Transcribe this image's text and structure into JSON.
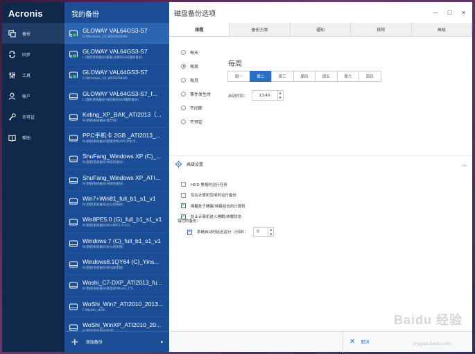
{
  "app": {
    "brand": "Acronis"
  },
  "nav": {
    "items": [
      {
        "label": "备份",
        "icon": "copy-icon",
        "active": true
      },
      {
        "label": "同步",
        "icon": "sync-icon",
        "active": false
      },
      {
        "label": "工具",
        "icon": "tools-icon",
        "active": false
      },
      {
        "label": "帐户",
        "icon": "user-icon",
        "active": false
      },
      {
        "label": "许可证",
        "icon": "key-icon",
        "active": false
      },
      {
        "label": "帮助",
        "icon": "book-icon",
        "active": false
      }
    ]
  },
  "backups": {
    "title": "我的备份",
    "items": [
      {
        "name": "GLOWAY VAL64GS3-S7",
        "path": "E:\\Windows_10_WSSSD\\BAK\\",
        "ok": true
      },
      {
        "name": "GLOWAY VAL64GS3-S7",
        "path": "L:\\我的系统备份\\最备\\龙鹰的SSD最新备份\\",
        "ok": true
      },
      {
        "name": "GLOWAY VAL64GS3-S7",
        "path": "E:\\Windows_10_WSSSD\\BAK\\",
        "ok": true
      },
      {
        "name": "GLOWAY VAL64GS3-S7_f...",
        "path": "L:\\我的系统备份\\书房备份SSD最新备份\\",
        "ok": false
      },
      {
        "name": "Keting_XP_BAK_ATI2013（...",
        "path": "N:\\我的系统备份\\客厅的\\",
        "ok": false
      },
      {
        "name": "PPC手机卡 2GB _ATI2013_...",
        "path": "N:\\我的系统备份\\智能手机\\PPC手机卡...",
        "ok": false
      },
      {
        "name": "ShuFang_Windows XP (C)_...",
        "path": "N:\\我的系统备份\\书房的备份\\",
        "ok": false
      },
      {
        "name": "ShuFang_Windows XP_ATI...",
        "path": "N:\\我的系统备份\\书房的备份\\",
        "ok": false
      },
      {
        "name": "Win7+Win81_full_b1_s1_v1",
        "path": "N:\\我的系统备份\\办公机系统\\",
        "ok": false
      },
      {
        "name": "Win8PE5.0 (G)_full_b1_s1_v1",
        "path": "N:\\我的系统备份\\Win8PE5.0 (G)\\",
        "ok": false
      },
      {
        "name": "Windows 7 (C)_full_b1_s1_v1",
        "path": "N:\\我的系统备份\\办公机系统\\",
        "ok": false
      },
      {
        "name": "Windows8.1QY64 (C)_Yins...",
        "path": "N:\\我的系统备份\\移动盘系统\\",
        "ok": false
      },
      {
        "name": "Woshi_C7-DXP_ATI2013_fu...",
        "path": "N:\\我的系统备份\\卧室的\\Woshi_C7\\",
        "ok": false
      },
      {
        "name": "WoShi_Win7_ATI2010_2013...",
        "path": "F:\\MyWin_BAK\\",
        "ok": false
      },
      {
        "name": "WoShi_WinXP_ATI2010_20...",
        "path": "N:\\我的系统备份\\卧室\\",
        "ok": false
      }
    ],
    "add_label": "添加备份"
  },
  "panel": {
    "title": "磁盘备份选项",
    "tabs": [
      {
        "label": "排程",
        "active": true
      },
      {
        "label": "备份方案",
        "active": false
      },
      {
        "label": "通知",
        "active": false
      },
      {
        "label": "排除",
        "active": false
      },
      {
        "label": "高级",
        "active": false
      }
    ],
    "schedule_options": [
      {
        "label": "每天",
        "selected": false
      },
      {
        "label": "每周",
        "selected": true
      },
      {
        "label": "每月",
        "selected": false
      },
      {
        "label": "事件发生时",
        "selected": false
      },
      {
        "label": "不间断",
        "selected": false
      },
      {
        "label": "不预定",
        "selected": false
      }
    ],
    "schedule_title": "每周",
    "weekdays": [
      {
        "label": "周一",
        "active": false
      },
      {
        "label": "周二",
        "active": true
      },
      {
        "label": "周三",
        "active": false
      },
      {
        "label": "周四",
        "active": false
      },
      {
        "label": "周五",
        "active": false
      },
      {
        "label": "周六",
        "active": false
      },
      {
        "label": "周日",
        "active": false
      }
    ],
    "start_time_label": "启动时间：",
    "start_time": "13:43",
    "advanced": {
      "title": "高级设置",
      "options": [
        {
          "label": "HDD 警报时运行任务",
          "checked": false
        },
        {
          "label": "仅在计算机空闲时运行备份",
          "checked": false
        },
        {
          "label": "唤醒处于睡眠/休眠状态的计算机",
          "checked": true
        },
        {
          "label": "防止计算机进入睡眠/休眠状态",
          "checked": true
        }
      ],
      "missed_label": "错过的备份：",
      "delay_label": "系统启动时延迟运行（分钟）：",
      "delay_checked": true,
      "delay_value": "0"
    },
    "cancel_label": "取消"
  },
  "watermark": {
    "text": "Baidu 经验",
    "sub": "jingyan.baidu.com"
  },
  "colors": {
    "nav_bg": "#10284a",
    "list_bg": "#1b4e96",
    "accent": "#2e6dc4",
    "ok": "#3ec25a"
  }
}
